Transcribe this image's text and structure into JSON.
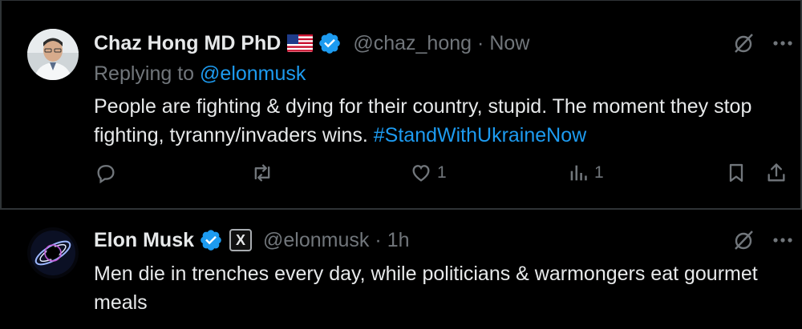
{
  "reply": {
    "author_name": "Chaz Hong MD PhD",
    "handle": "@chaz_hong",
    "separator": "·",
    "time": "Now",
    "replying_prefix": "Replying to",
    "replying_to": "@elonmusk",
    "text_main": "People are fighting & dying for their country, stupid. The moment they stop fighting, tyranny/invaders wins. ",
    "hashtag": "#StandWithUkraineNow",
    "likes": "1",
    "views": "1"
  },
  "original": {
    "author_name": "Elon Musk",
    "badge_letter": "X",
    "handle": "@elonmusk",
    "separator": "·",
    "time": "1h",
    "text": "Men die in trenches every day, while politicians & warmongers eat gourmet meals"
  },
  "colors": {
    "background": "#000000",
    "divider": "#2f3336",
    "muted": "#71767b",
    "accent": "#1d9bf0",
    "text": "#e7e9ea"
  },
  "icons": {
    "verified": "verified-badge-icon",
    "grok": "grok-icon",
    "more": "more-icon",
    "reply": "reply-icon",
    "retweet": "retweet-icon",
    "like": "heart-icon",
    "views": "views-icon",
    "bookmark": "bookmark-icon",
    "share": "share-icon"
  }
}
